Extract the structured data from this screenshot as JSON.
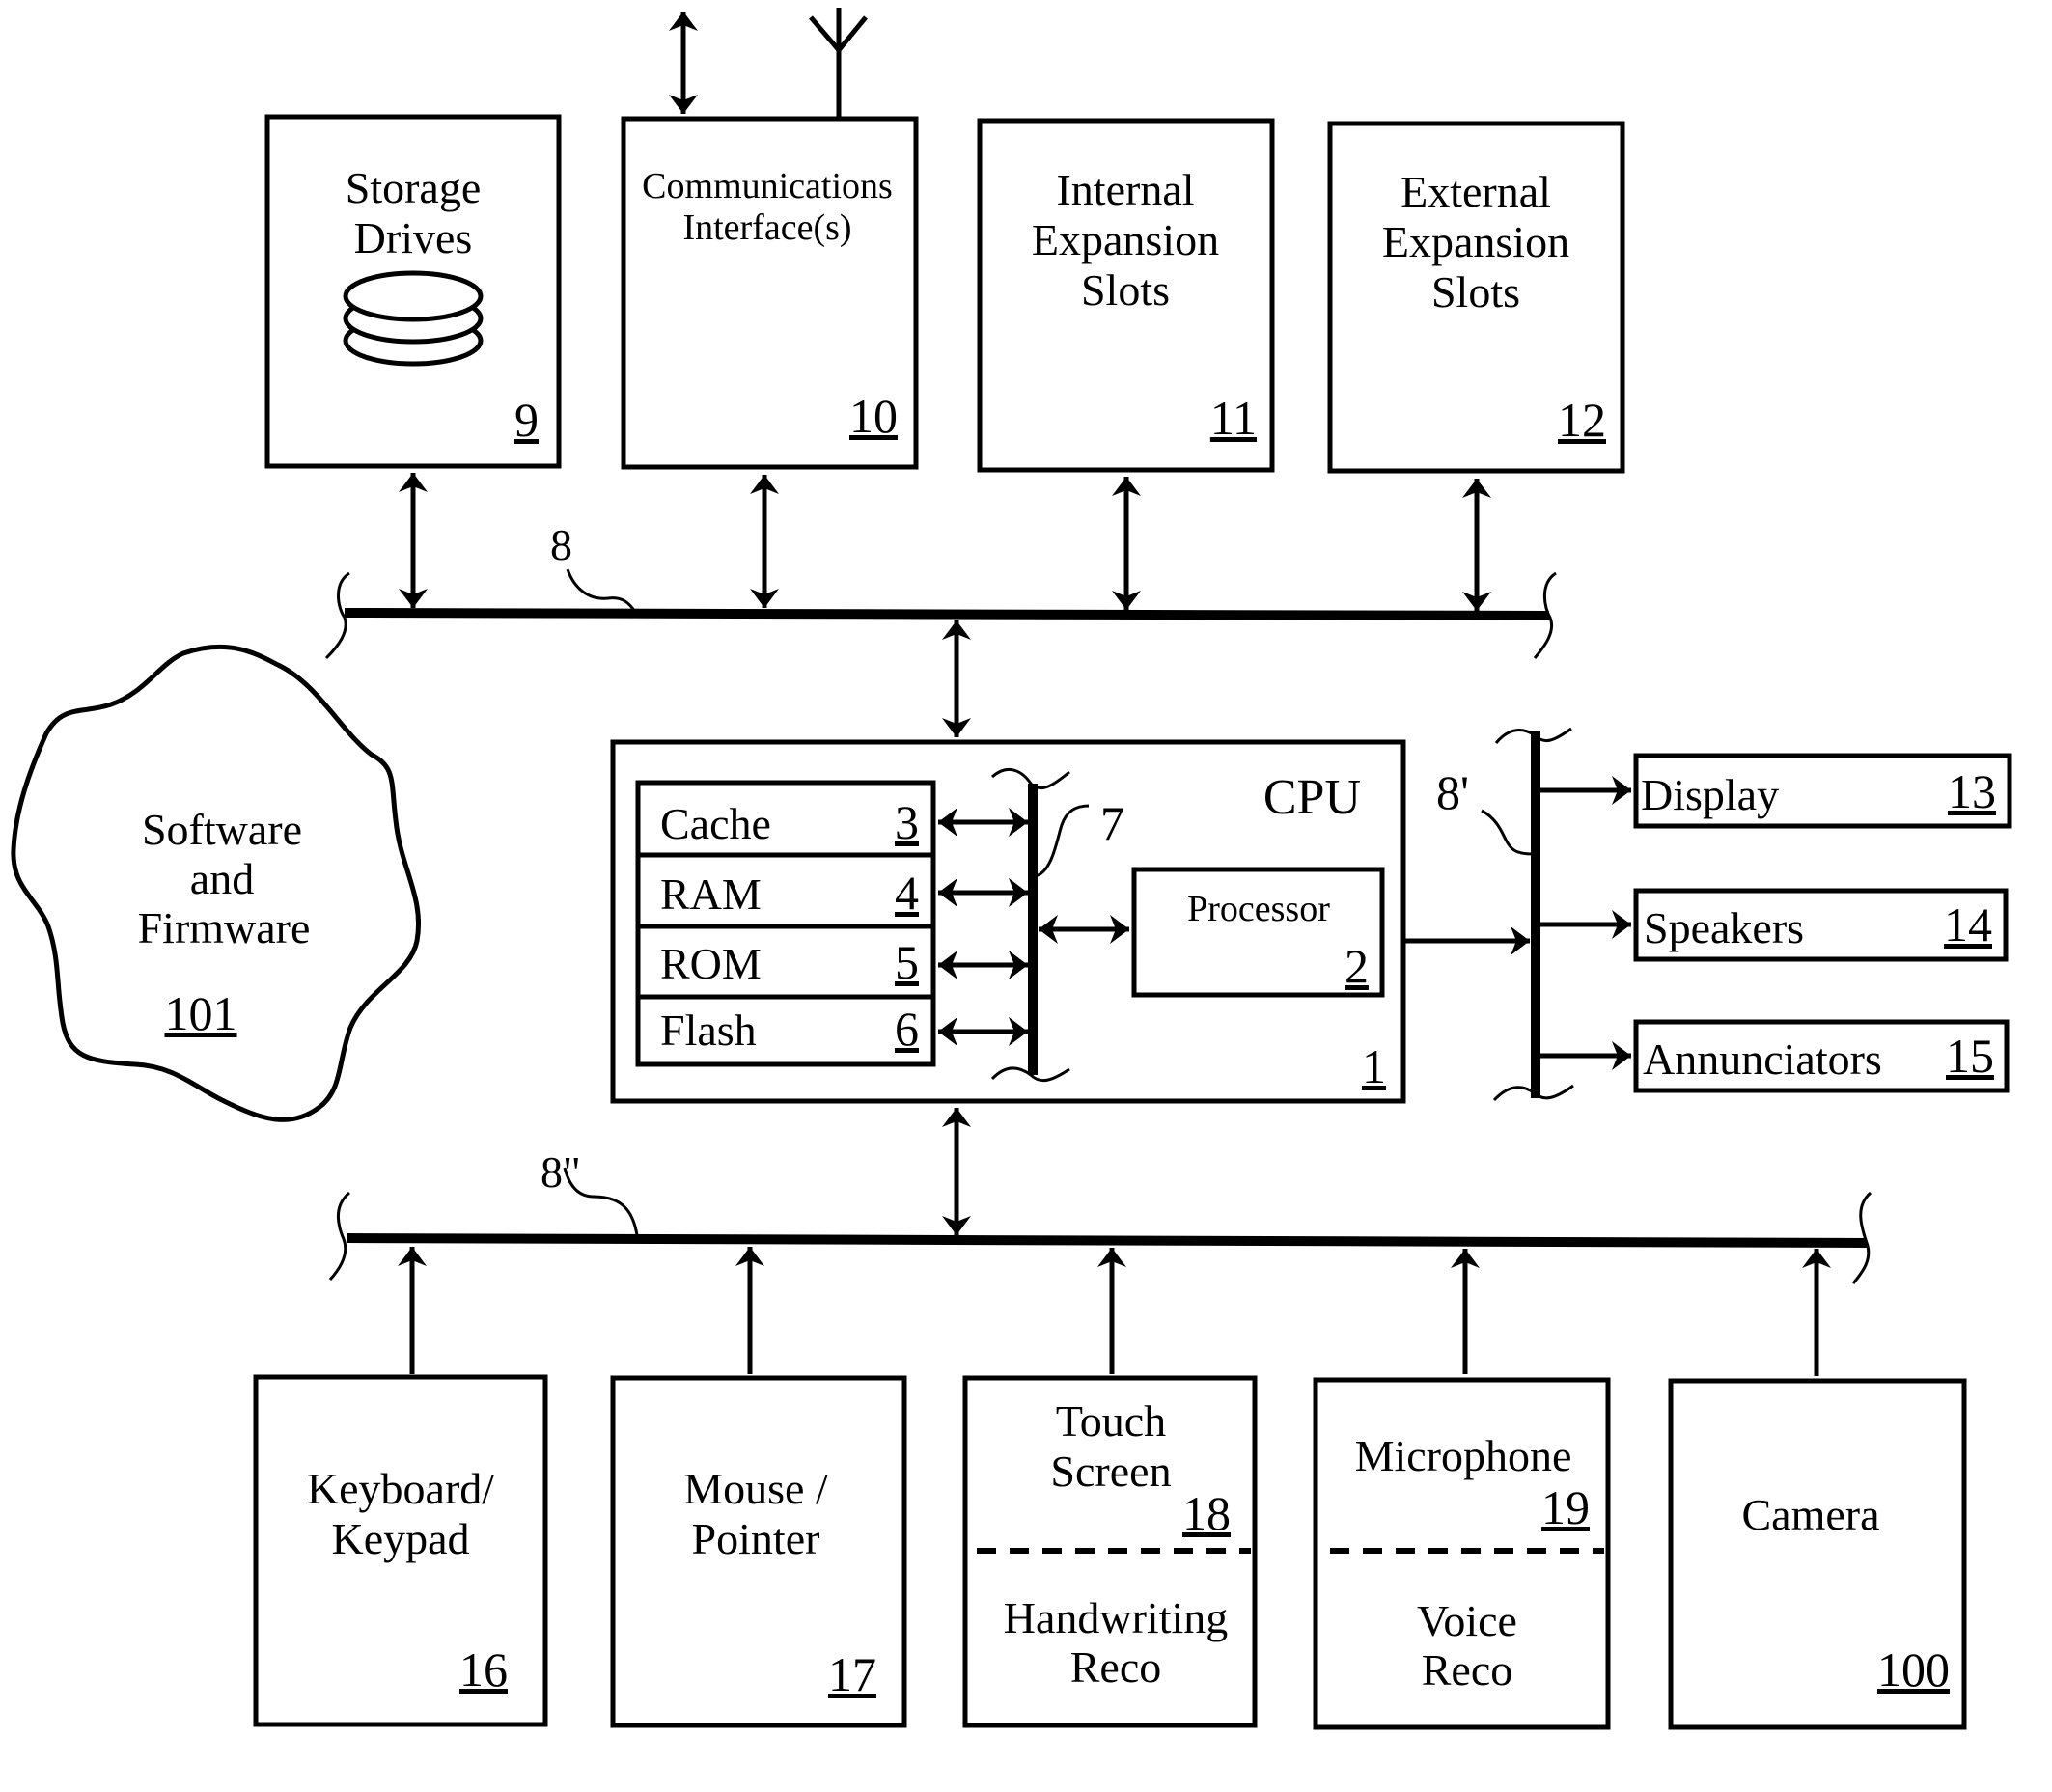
{
  "figure": {
    "type": "block diagram",
    "subject": "computer system architecture",
    "stroke_color": "#000000",
    "background_color": "#ffffff"
  },
  "buses": {
    "system_bus": {
      "ref": "8"
    },
    "output_bus": {
      "ref": "8'"
    },
    "input_bus": {
      "ref": "8\""
    },
    "internal_bus": {
      "ref": "7"
    }
  },
  "top_blocks": [
    {
      "lines": [
        "Storage",
        "Drives"
      ],
      "ref": "9",
      "icon": "disk-stack-icon",
      "connection": "bidirectional"
    },
    {
      "lines": [
        "Communications",
        "Interface(s)"
      ],
      "ref": "10",
      "icon": "antenna-icon",
      "connection": "bidirectional",
      "external_link": "bidirectional"
    },
    {
      "lines": [
        "Internal",
        "Expansion",
        "Slots"
      ],
      "ref": "11",
      "connection": "bidirectional"
    },
    {
      "lines": [
        "External",
        "Expansion",
        "Slots"
      ],
      "ref": "12",
      "connection": "bidirectional"
    }
  ],
  "cpu": {
    "title": "CPU",
    "ref": "1",
    "memory": [
      {
        "label": "Cache",
        "ref": "3"
      },
      {
        "label": "RAM",
        "ref": "4"
      },
      {
        "label": "ROM",
        "ref": "5"
      },
      {
        "label": "Flash",
        "ref": "6"
      }
    ],
    "processor": {
      "label": "Processor",
      "ref": "2"
    }
  },
  "software": {
    "lines": [
      "Software",
      "and",
      "Firmware"
    ],
    "ref": "101"
  },
  "outputs": [
    {
      "label": "Display",
      "ref": "13"
    },
    {
      "label": "Speakers",
      "ref": "14"
    },
    {
      "label": "Annunciators",
      "ref": "15"
    }
  ],
  "inputs": [
    {
      "top_lines": [
        "Keyboard/",
        "Keypad"
      ],
      "ref": "16"
    },
    {
      "top_lines": [
        "Mouse /",
        "Pointer"
      ],
      "ref": "17"
    },
    {
      "top_lines": [
        "Touch",
        "Screen"
      ],
      "ref": "18",
      "bottom_lines": [
        "Handwriting",
        "Reco"
      ]
    },
    {
      "top_lines": [
        "Microphone"
      ],
      "ref": "19",
      "bottom_lines": [
        "Voice",
        "Reco"
      ]
    },
    {
      "top_lines": [
        "Camera"
      ],
      "ref": "100"
    }
  ]
}
